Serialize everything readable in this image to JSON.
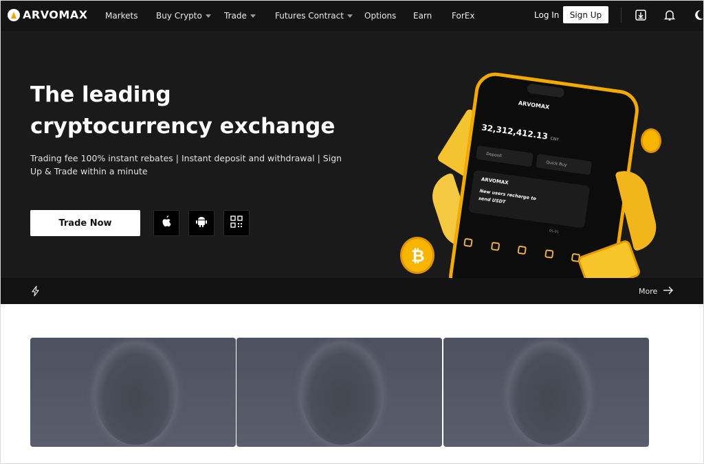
{
  "brand": {
    "name": "ARVOMAX"
  },
  "nav": {
    "items": [
      {
        "label": "Markets",
        "has_caret": false
      },
      {
        "label": "Buy Crypto",
        "has_caret": true
      },
      {
        "label": "Trade",
        "has_caret": true
      },
      {
        "label": "Futures Contract",
        "has_caret": true
      },
      {
        "label": "Options",
        "has_caret": false
      },
      {
        "label": "Earn",
        "has_caret": false
      },
      {
        "label": "ForEx",
        "has_caret": false
      }
    ],
    "login_label": "Log In",
    "signup_label": "Sign Up",
    "icons": [
      "download-icon",
      "bell-icon",
      "moon-icon"
    ]
  },
  "hero": {
    "title": "The leading cryptocurrency exchange",
    "subtitle": "Trading fee 100% instant rebates  | Instant deposit and withdrawal |  Sign Up & Trade within a minute",
    "cta_label": "Trade Now",
    "app_buttons": [
      "apple-icon",
      "android-icon",
      "qr-code-icon"
    ]
  },
  "phone": {
    "brand": "ARVOMAX",
    "balance": "32,312,412.13",
    "currency": "CNY",
    "deposit_label": "Deposit",
    "quick_buy_label": "Quick Buy",
    "card_brand": "ARVOMAX",
    "card_text": "New users recharge to send USDT",
    "date": "05-01"
  },
  "ticker": {
    "more_label": "More"
  },
  "colors": {
    "accent": "#f2a900",
    "nav_bg": "#141414",
    "hero_bg": "#1a1a1a",
    "ticker_bg": "#121212"
  },
  "cards": [
    {
      "image": "moon-image"
    },
    {
      "image": "moon-image"
    },
    {
      "image": "moon-image"
    }
  ]
}
